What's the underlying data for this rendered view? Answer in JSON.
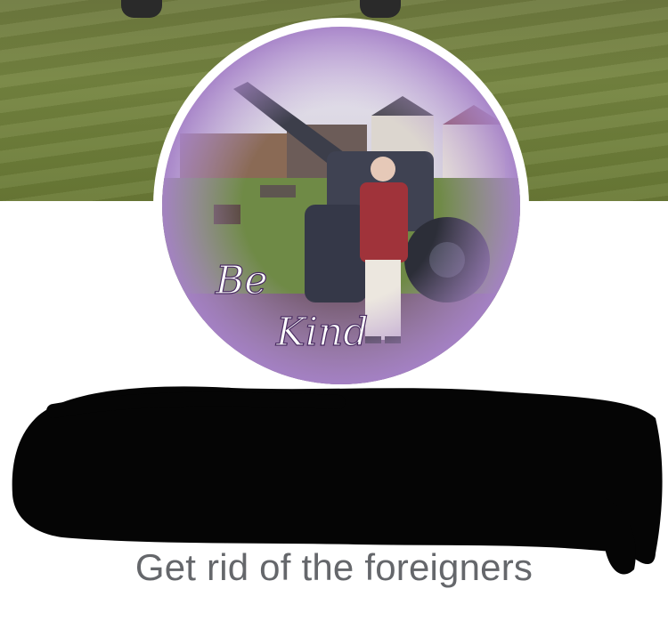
{
  "profile": {
    "photo_overlay_line1": "Be",
    "photo_overlay_line2": "Kind",
    "display_name": "",
    "bio": "Get rid of the foreigners"
  },
  "colors": {
    "bio_text": "#65676b",
    "redaction": "#050505",
    "photo_tint": "#b79ad3"
  }
}
